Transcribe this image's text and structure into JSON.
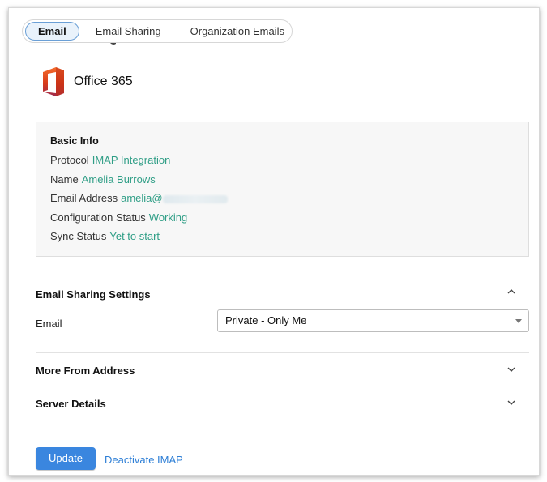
{
  "tabs": [
    {
      "label": "Email"
    },
    {
      "label": "Email Sharing"
    },
    {
      "label": "Organization Emails"
    }
  ],
  "brand": {
    "name": "Office 365"
  },
  "basic_info": {
    "heading": "Basic Info",
    "rows": [
      {
        "label": "Protocol",
        "value": "IMAP Integration"
      },
      {
        "label": "Name",
        "value": "Amelia Burrows"
      },
      {
        "label": "Email Address",
        "value": "amelia@"
      },
      {
        "label": "Configuration Status",
        "value": "Working"
      },
      {
        "label": "Sync Status",
        "value": "Yet to start"
      }
    ]
  },
  "sharing": {
    "title": "Email Sharing Settings",
    "field_label": "Email",
    "selected": "Private - Only Me"
  },
  "more_from": {
    "title": "More From Address"
  },
  "server": {
    "title": "Server Details"
  },
  "actions": {
    "update": "Update",
    "deactivate": "Deactivate IMAP"
  },
  "colors": {
    "accent": "#3a86df",
    "value_text": "#2f9e86",
    "link": "#2e7fd6"
  }
}
